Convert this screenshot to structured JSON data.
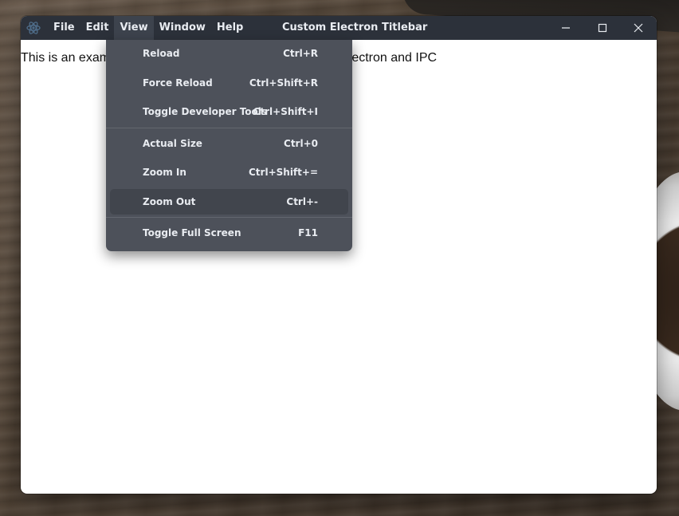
{
  "window": {
    "title": "Custom Electron Titlebar",
    "menu": [
      "File",
      "Edit",
      "View",
      "Window",
      "Help"
    ],
    "active_menu": "View",
    "controls": {
      "minimize_icon": "minimize-icon",
      "maximize_icon": "maximize-icon",
      "close_icon": "close-icon"
    }
  },
  "content": {
    "text": "This is an example custom titlebar made with the help of electron and IPC"
  },
  "view_menu": {
    "items": [
      {
        "label": "Reload",
        "accelerator": "Ctrl+R"
      },
      {
        "label": "Force Reload",
        "accelerator": "Ctrl+Shift+R"
      },
      {
        "label": "Toggle Developer Tools",
        "accelerator": "Ctrl+Shift+I"
      },
      {
        "label": "Actual Size",
        "accelerator": "Ctrl+0"
      },
      {
        "label": "Zoom In",
        "accelerator": "Ctrl+Shift+="
      },
      {
        "label": "Zoom Out",
        "accelerator": "Ctrl+-"
      },
      {
        "label": "Toggle Full Screen",
        "accelerator": "F11"
      }
    ],
    "hovered_item": "Zoom Out"
  },
  "colors": {
    "titlebar": "#2c313a",
    "menu_background": "#4d515a",
    "menu_hover": "#41454d",
    "text_light": "#e9ecf1"
  }
}
